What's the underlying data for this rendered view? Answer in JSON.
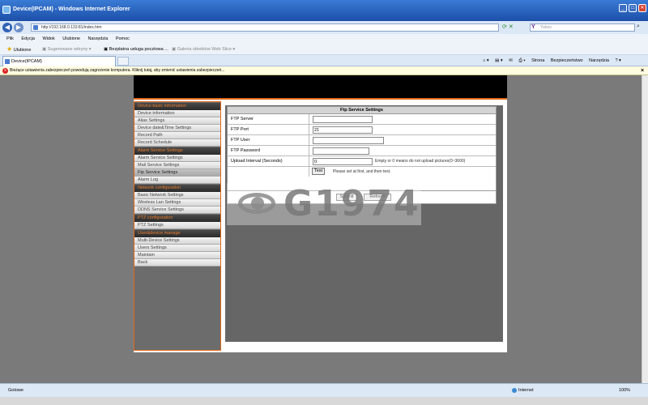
{
  "window": {
    "title": "Device(IPCAM) - Windows Internet Explorer"
  },
  "browser": {
    "address": "http://192.168.0.133:81/index.htm",
    "search_placeholder": "Yahoo",
    "menu": [
      "Plik",
      "Edycja",
      "Widok",
      "Ulubione",
      "Narzędzia",
      "Pomoc"
    ],
    "favorites": {
      "label": "Ulubione",
      "items": [
        "Sugerowane witryny",
        "Bezpłatna usługa pocztowa ...",
        "Galeria obiektów Web Slice"
      ]
    },
    "tab": "Device(IPCAM)",
    "commands": [
      "Strona",
      "Bezpieczeństwo",
      "Narzędzia"
    ],
    "infobar": "Bieżące ustawienia zabezpieczeń powodują zagrożenie komputera. Kliknij tutaj, aby zmienić ustawienia zabezpieczeń...",
    "status": {
      "ready": "Gotowe",
      "zone": "Internet",
      "zoom": "100%"
    }
  },
  "sidebar": [
    {
      "type": "head",
      "label": "Device basic information"
    },
    {
      "type": "item",
      "label": "Device information"
    },
    {
      "type": "item",
      "label": "Alias Settings"
    },
    {
      "type": "item",
      "label": "Device date&Time Settings"
    },
    {
      "type": "item",
      "label": "Record Path"
    },
    {
      "type": "item",
      "label": "Record Schedule"
    },
    {
      "type": "head",
      "label": "Alarm Service Settings"
    },
    {
      "type": "item",
      "label": "Alarm Service Settings"
    },
    {
      "type": "item",
      "label": "Mail Service Settings"
    },
    {
      "type": "item",
      "label": "Ftp Service Settings",
      "active": true
    },
    {
      "type": "item",
      "label": "Alarm Log"
    },
    {
      "type": "head",
      "label": "Network configuration"
    },
    {
      "type": "item",
      "label": "Basic Network Settings"
    },
    {
      "type": "item",
      "label": "Wireless Lan Settings"
    },
    {
      "type": "item",
      "label": "DDNS Service Settings"
    },
    {
      "type": "head",
      "label": "PTZ configuration"
    },
    {
      "type": "item",
      "label": "PTZ Settings"
    },
    {
      "type": "head",
      "label": "User&device manage"
    },
    {
      "type": "item",
      "label": "Multi-Device Settings"
    },
    {
      "type": "item",
      "label": "Users Settings"
    },
    {
      "type": "item",
      "label": "Maintain"
    },
    {
      "type": "item",
      "label": "Back"
    }
  ],
  "ftp": {
    "title": "Ftp Service Settings",
    "server_label": "FTP Server",
    "server_value": "",
    "port_label": "FTP Port",
    "port_value": "21",
    "user_label": "FTP User",
    "user_value": "",
    "password_label": "FTP Password",
    "password_value": "",
    "interval_label": "Upload Interval (Seconds)",
    "interval_value": "0",
    "interval_hint": "Empty or 0 means do not upload pictures(0~3600)",
    "test_label": "Test",
    "test_hint": "Please set at first, and then test.",
    "submit_label": "Submit",
    "refresh_label": "Refresh"
  },
  "watermark": "G1974"
}
